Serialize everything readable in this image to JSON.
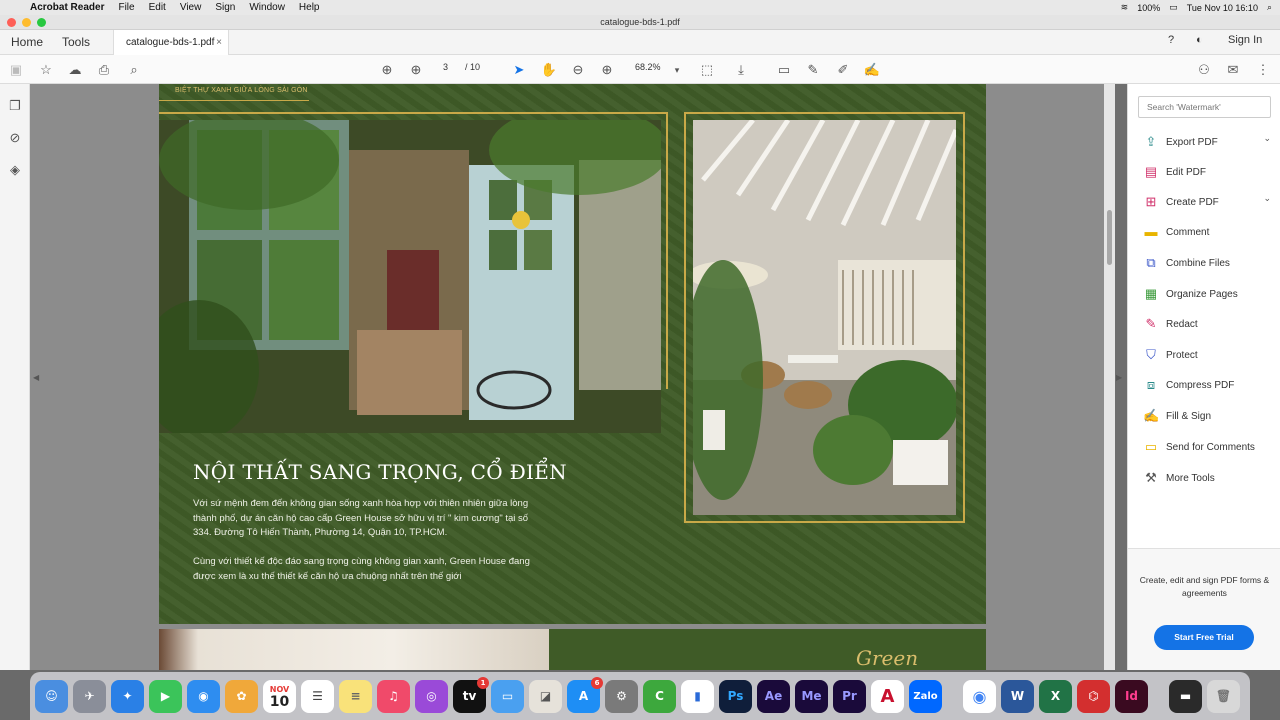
{
  "menubar": {
    "app_name": "Acrobat Reader",
    "items": [
      "File",
      "Edit",
      "View",
      "Sign",
      "Window",
      "Help"
    ],
    "battery": "100%",
    "clock": "Tue Nov 10  16:10"
  },
  "window": {
    "title": "catalogue-bds-1.pdf"
  },
  "tabs": {
    "home": "Home",
    "tools": "Tools",
    "doc_tab": "catalogue-bds-1.pdf",
    "close": "×",
    "sign_in": "Sign In"
  },
  "toolbar": {
    "page_current": "3",
    "page_total": "/ 10",
    "zoom": "68.2%"
  },
  "page": {
    "subtitle": "BIỆT THỰ XANH GIỮA LÒNG SÀI GÒN",
    "heading": "NỘI THẤT SANG TRỌNG, CỔ ĐIỂN",
    "para1": "Với sứ mệnh đem đến không gian sống xanh hòa hợp với thiên nhiên giữa lòng thành phố, dự án căn hộ cao cấp Green House sở hữu vị trí \" kim cương\" tại số 334. Đường Tô Hiến Thành, Phường 14, Quận 10, TP.HCM.",
    "para2": "Cùng với thiết kế độc đáo sang trọng cùng không gian xanh, Green House đang được xem là xu thế thiết kế căn hộ ưa chuộng nhất trên thế giới",
    "brand": "Green House"
  },
  "right_panel": {
    "search_placeholder": "Search 'Watermark'",
    "tools": [
      {
        "label": "Export PDF",
        "color": "#2a8a8a"
      },
      {
        "label": "Edit PDF",
        "color": "#d0306a"
      },
      {
        "label": "Create PDF",
        "color": "#d0306a"
      },
      {
        "label": "Comment",
        "color": "#e8b400"
      },
      {
        "label": "Combine Files",
        "color": "#3955c8"
      },
      {
        "label": "Organize Pages",
        "color": "#3a9a3a"
      },
      {
        "label": "Redact",
        "color": "#d0306a"
      },
      {
        "label": "Protect",
        "color": "#3955c8"
      },
      {
        "label": "Compress PDF",
        "color": "#2a8a8a"
      },
      {
        "label": "Fill & Sign",
        "color": "#6a3ab0"
      },
      {
        "label": "Send for Comments",
        "color": "#e8b400"
      },
      {
        "label": "More Tools",
        "color": "#555555"
      }
    ],
    "promo_text": "Create, edit and sign PDF forms & agreements",
    "trial_button": "Start Free Trial"
  },
  "dock": {
    "calendar_month": "NOV",
    "calendar_day": "10",
    "appletv_badge": "1",
    "appstore_badge": "6",
    "labels": {
      "ps": "Ps",
      "ae": "Ae",
      "me": "Me",
      "pr": "Pr",
      "zalo": "Zalo",
      "id": "Id",
      "w": "W",
      "x": "X"
    }
  }
}
